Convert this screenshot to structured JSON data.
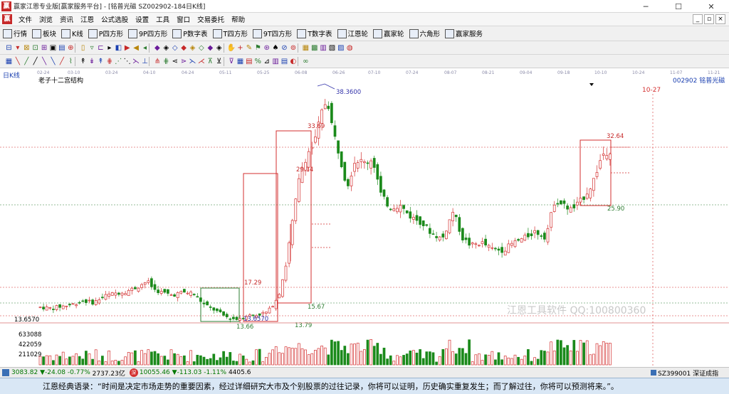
{
  "window": {
    "title": "赢家江恩专业版[赢家服务平台] - [铭普光磁  SZ002902-184日K线]",
    "app_icon": "赢",
    "minimize": "─",
    "maximize": "☐",
    "close": "✕"
  },
  "menu": {
    "logo": "赢",
    "items": [
      "文件",
      "浏览",
      "资讯",
      "江恩",
      "公式选股",
      "设置",
      "工具",
      "窗口",
      "交易委托",
      "帮助"
    ],
    "mdi_controls": [
      "_",
      "▫",
      "×"
    ]
  },
  "toolbar1": {
    "items": [
      {
        "label": "行情",
        "icon": "grid-icon"
      },
      {
        "label": "板块",
        "icon": "blocks-icon"
      },
      {
        "label": "K线",
        "icon": "candle-icon"
      },
      {
        "label": "P四方形",
        "icon": "square-p-icon"
      },
      {
        "label": "9P四方形",
        "icon": "square-9p-icon"
      },
      {
        "label": "P数字表",
        "icon": "table-p-icon"
      },
      {
        "label": "T四方形",
        "icon": "square-t-icon"
      },
      {
        "label": "9T四方形",
        "icon": "square-9t-icon"
      },
      {
        "label": "T数字表",
        "icon": "table-t-icon"
      },
      {
        "label": "江恩轮",
        "icon": "wheel-icon"
      },
      {
        "label": "赢家轮",
        "icon": "wheel2-icon"
      },
      {
        "label": "六角形",
        "icon": "hexagon-icon"
      },
      {
        "label": "赢家服务",
        "icon": "service-icon"
      }
    ]
  },
  "toolbar2": {
    "glyphs": [
      "⊟",
      "▾",
      "⊠",
      "⊡",
      "⊞",
      "▣",
      "▤",
      "⊕",
      "▯",
      "▿",
      "⊏",
      "▸",
      "◧",
      "▶",
      "◀",
      "◂",
      "◆",
      "◈",
      "◇",
      "◆",
      "◈",
      "◇",
      "◆",
      "◈",
      "✋",
      "+",
      "✎",
      "⚑",
      "⊛",
      "♠",
      "⊘",
      "⊚",
      "▦",
      "▩",
      "▥",
      "▧",
      "▨",
      "◍"
    ]
  },
  "toolbar3": {
    "glyphs": [
      "▦",
      "╲",
      "╱",
      "╱",
      "╲",
      "╲",
      "╱",
      "⌇",
      "↟",
      "↡",
      "↟",
      "⋕",
      "⋰",
      "⋱",
      "⋋",
      "⊥",
      "⋔",
      "⋕",
      "⋖",
      "⋗",
      "⋋",
      "⋌",
      "⊼",
      "⊻",
      "⊽",
      "▦",
      "▤",
      "%",
      "⊿",
      "▥",
      "▤",
      "◐",
      "∞"
    ]
  },
  "chart": {
    "period_label": "日K线",
    "structure_label": "老子十二宫结构",
    "stock_label": "002902  铭普光磁",
    "date_marker": "10-27",
    "x_dates": [
      "02-24",
      "03-10",
      "03-24",
      "04-10",
      "04-24",
      "05-11",
      "05-25",
      "06-08",
      "06-26",
      "07-10",
      "07-24",
      "08-07",
      "08-21",
      "09-04",
      "09-18",
      "10-10",
      "10-24",
      "11-07",
      "11-21"
    ],
    "annotations": [
      {
        "text": "38.3600",
        "color": "#3333aa"
      },
      {
        "text": "33.69",
        "color": "#c62828"
      },
      {
        "text": "29.14",
        "color": "#c62828"
      },
      {
        "text": "17.29",
        "color": "#c62828"
      },
      {
        "text": "15.67",
        "color": "#2e7d32"
      },
      {
        "text": "13.66",
        "color": "#2e7d32"
      },
      {
        "text": "13.79",
        "color": "#2e7d32"
      },
      {
        "text": "13.6570",
        "color": "#3333aa"
      },
      {
        "text": "32.64",
        "color": "#c62828"
      },
      {
        "text": "25.90",
        "color": "#2e7d32"
      }
    ],
    "left_price": "13.6570",
    "volume_ticks": [
      "633088",
      "422059",
      "211029"
    ],
    "watermark": "江恩工具软件  QQ:100800360",
    "colors": {
      "up": "#d32f2f",
      "down": "#1b8a1b",
      "box_red": "#d32f2f",
      "box_green": "#2e7d32"
    }
  },
  "chart_data": {
    "type": "candlestick",
    "x_range": [
      "02-24",
      "11-21"
    ],
    "y_range": [
      13.0,
      40.0
    ],
    "key_levels": [
      38.36,
      33.69,
      29.14,
      17.29,
      15.67,
      13.79,
      13.66,
      13.657,
      32.64,
      25.9
    ],
    "lows_highs": [
      {
        "label": "low",
        "value": 13.657
      },
      {
        "label": "high",
        "value": 38.36
      },
      {
        "label": "recent_high",
        "value": 32.64
      },
      {
        "label": "recent_low",
        "value": 25.9
      }
    ]
  },
  "status": {
    "sh_index": "3083.82",
    "sh_change": "▼-24.08",
    "sh_pct": "-0.77%",
    "sh_amount": "2737.23亿",
    "sz_icon": "深",
    "sz_index": "10055.46",
    "sz_change": "▼-113.03",
    "sz_pct": "-1.11%",
    "sz_amount": "4405.6",
    "right_code": "SZ399001  深证成指"
  },
  "quote": "江恩经典语录：“时间是决定市场走势的重要因素，经过详细研究大市及个别股票的过往记录，你将可以证明，历史确实重复发生；而了解过往，你将可以预测将来。”。"
}
